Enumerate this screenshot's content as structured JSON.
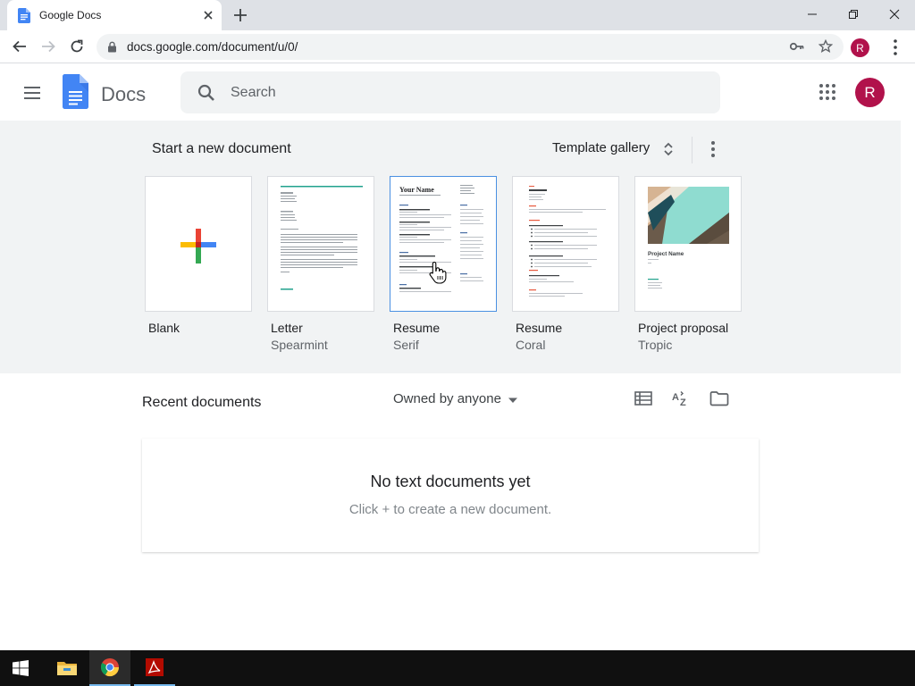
{
  "browser": {
    "tab_title": "Google Docs",
    "url": "docs.google.com/document/u/0/",
    "profile_initial": "R"
  },
  "header": {
    "app_name": "Docs",
    "search_placeholder": "Search",
    "avatar_initial": "R"
  },
  "templates": {
    "section_title": "Start a new document",
    "gallery_label": "Template gallery",
    "items": [
      {
        "name": "Blank",
        "sub": ""
      },
      {
        "name": "Letter",
        "sub": "Spearmint"
      },
      {
        "name": "Resume",
        "sub": "Serif"
      },
      {
        "name": "Resume",
        "sub": "Coral"
      },
      {
        "name": "Project proposal",
        "sub": "Tropic"
      }
    ],
    "resume_serif_heading": "Your Name",
    "proposal_heading": "Project Name"
  },
  "recent": {
    "title": "Recent documents",
    "owner_filter": "Owned by anyone",
    "empty_title": "No text documents yet",
    "empty_sub": "Click + to create a new document."
  },
  "colors": {
    "docs_blue": "#4285f4",
    "avatar": "#b1124b",
    "gray_bg": "#f1f3f4"
  }
}
